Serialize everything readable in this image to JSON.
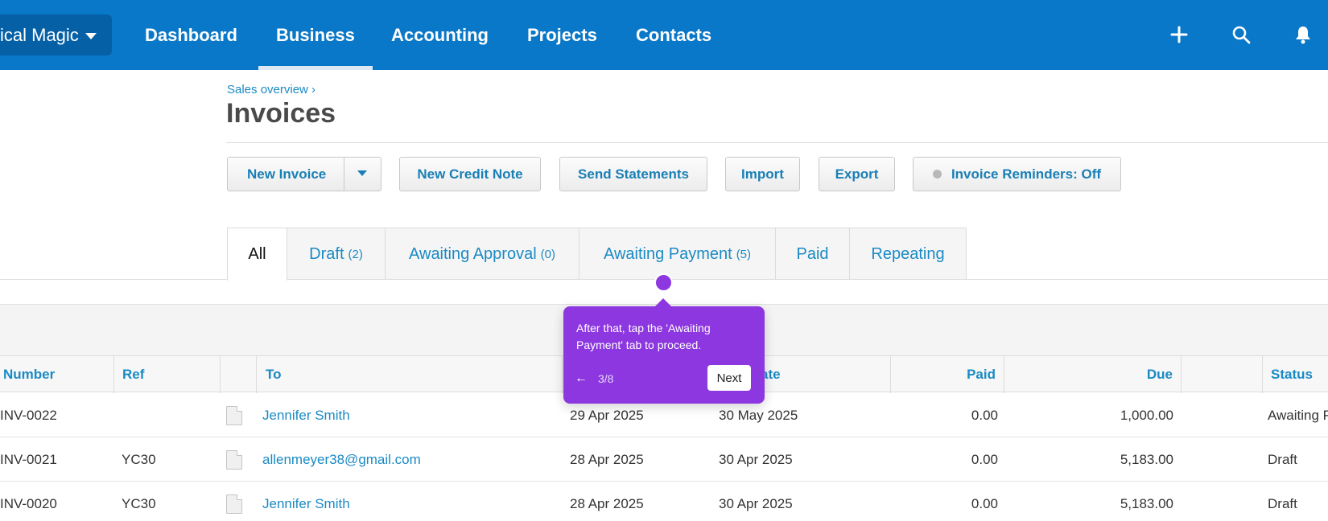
{
  "nav": {
    "org_name": "ical Magic",
    "items": [
      "Dashboard",
      "Business",
      "Accounting",
      "Projects",
      "Contacts"
    ],
    "active": "Business",
    "icons": [
      "plus-icon",
      "search-icon",
      "bell-icon"
    ]
  },
  "header": {
    "breadcrumb": "Sales overview ›",
    "title": "Invoices"
  },
  "toolbar": {
    "new_invoice": "New Invoice",
    "new_credit_note": "New Credit Note",
    "send_statements": "Send Statements",
    "import": "Import",
    "export": "Export",
    "reminders": "Invoice Reminders: Off"
  },
  "tabs": [
    {
      "label": "All",
      "count": ""
    },
    {
      "label": "Draft",
      "count": "(2)"
    },
    {
      "label": "Awaiting Approval",
      "count": "(0)"
    },
    {
      "label": "Awaiting Payment",
      "count": "(5)"
    },
    {
      "label": "Paid",
      "count": ""
    },
    {
      "label": "Repeating",
      "count": ""
    }
  ],
  "table": {
    "headers": {
      "number": "Number",
      "ref": "Ref",
      "to": "To",
      "due_date": "ate",
      "paid": "Paid",
      "due": "Due",
      "status": "Status"
    },
    "rows": [
      {
        "number": "INV-0022",
        "ref": "",
        "to": "Jennifer Smith",
        "date": "29 Apr 2025",
        "due_date": "30 May 2025",
        "paid": "0.00",
        "due": "1,000.00",
        "status": "Awaiting P"
      },
      {
        "number": "INV-0021",
        "ref": "YC30",
        "to": "allenmeyer38@gmail.com",
        "date": "28 Apr 2025",
        "due_date": "30 Apr 2025",
        "paid": "0.00",
        "due": "5,183.00",
        "status": "Draft"
      },
      {
        "number": "INV-0020",
        "ref": "YC30",
        "to": "Jennifer Smith",
        "date": "28 Apr 2025",
        "due_date": "30 Apr 2025",
        "paid": "0.00",
        "due": "5,183.00",
        "status": "Draft"
      }
    ]
  },
  "guide": {
    "text": "After that, tap the 'Awaiting Payment' tab to proceed.",
    "back": "←",
    "step": "3/8",
    "next": "Next",
    "color": "#8d37e0"
  },
  "colors": {
    "nav_bg": "#0a78c8",
    "link": "#1a8ac4"
  }
}
